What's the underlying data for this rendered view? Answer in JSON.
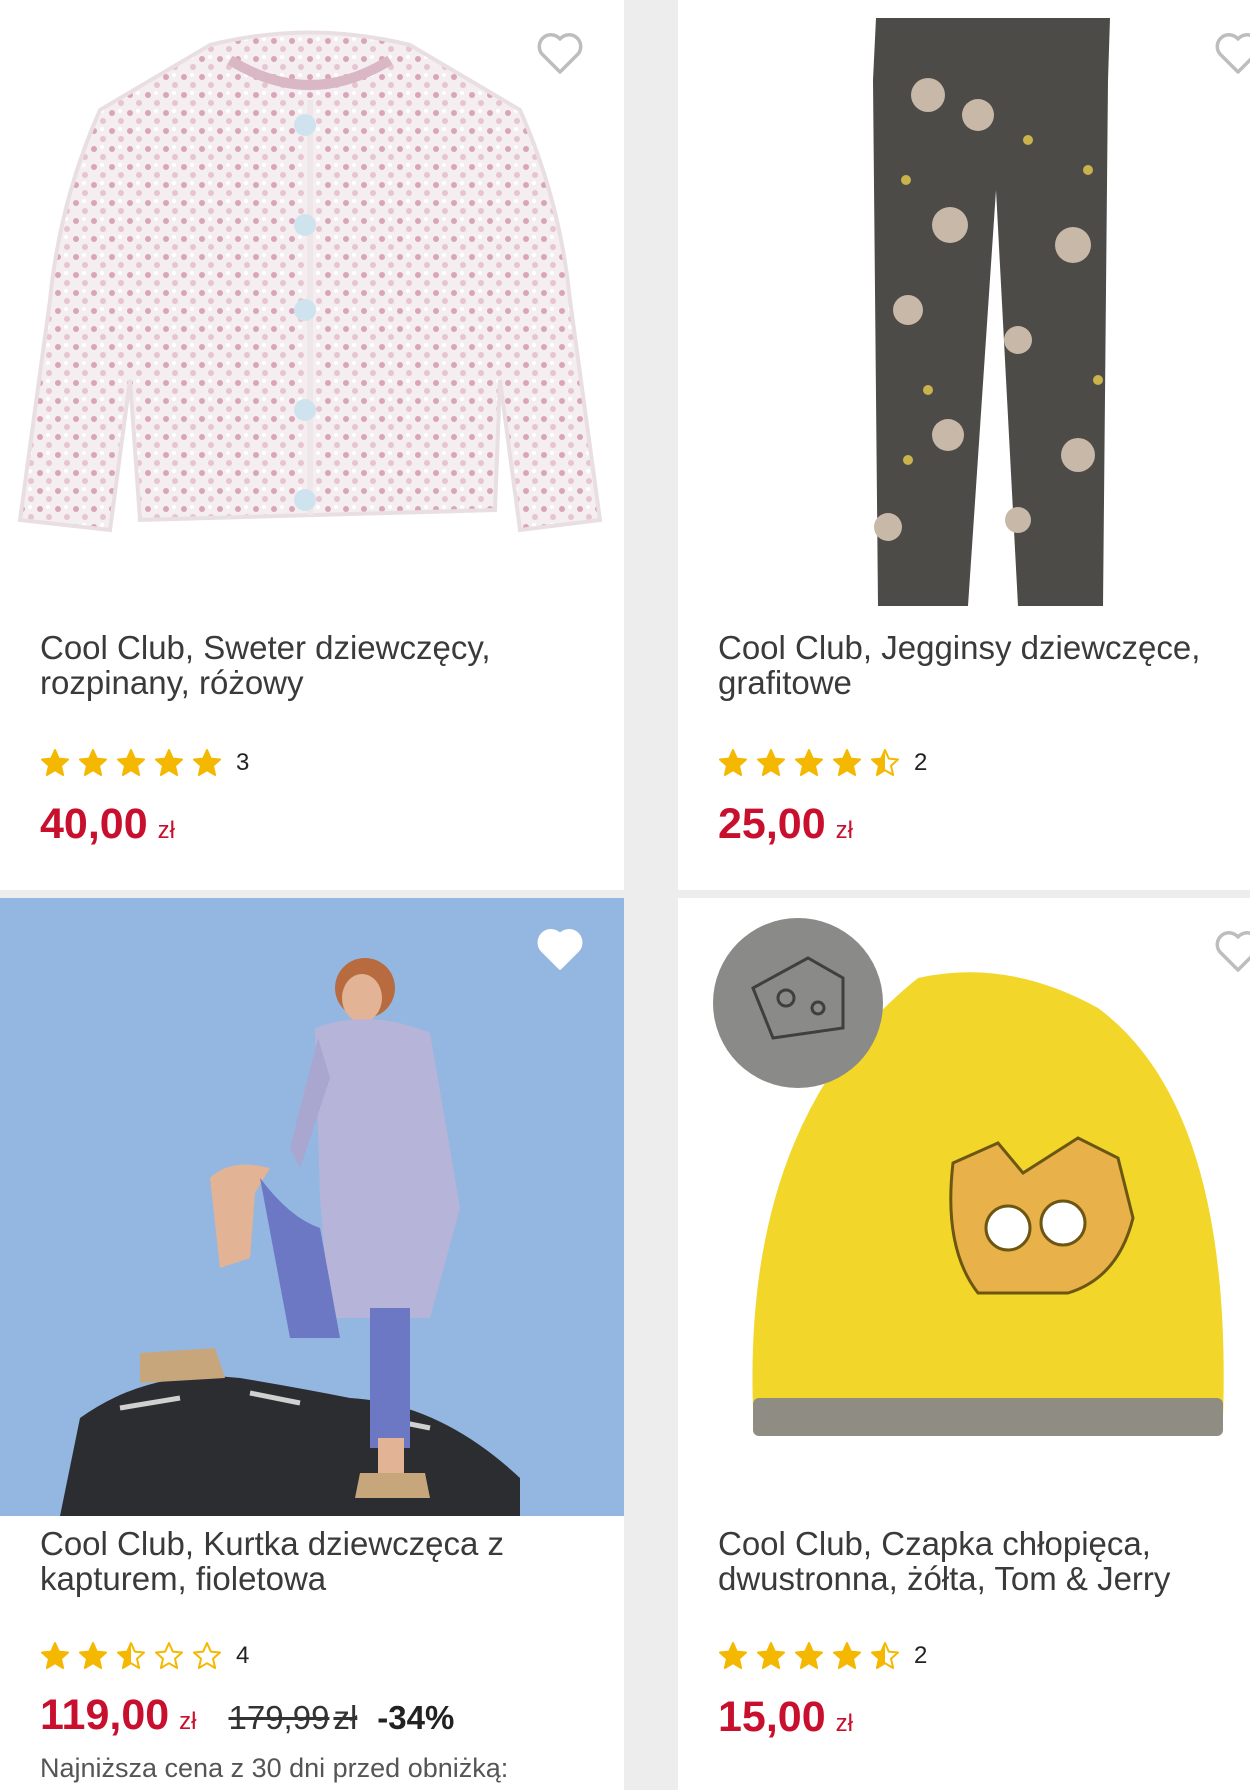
{
  "products": [
    {
      "title": "Cool Club, Sweter dziewczęcy, rozpinany, różowy",
      "rating": 5,
      "reviews": "3",
      "price": "40,00",
      "currency": "zł"
    },
    {
      "title": "Cool Club, Jegginsy dziewczęce, grafitowe",
      "rating": 4.5,
      "reviews": "2",
      "price": "25,00",
      "currency": "zł"
    },
    {
      "title": "Cool Club, Kurtka dziewczęca z kapturem, fioletowa",
      "rating": 2.5,
      "reviews": "4",
      "price": "119,00",
      "currency": "zł",
      "old_price": "179,99",
      "old_currency": "zł",
      "discount": "-34%",
      "lowest_price_note": "Najniższa cena z 30 dni przed obniżką:"
    },
    {
      "title": "Cool Club, Czapka chłopięca, dwustronna, żółta, Tom & Jerry",
      "rating": 4.5,
      "reviews": "2",
      "price": "15,00",
      "currency": "zł"
    }
  ],
  "colors": {
    "price": "#c8102e",
    "star": "#f5b800",
    "heart": "#bdbdbd"
  },
  "icons": [
    "heart-outline-icon",
    "star-icon"
  ]
}
